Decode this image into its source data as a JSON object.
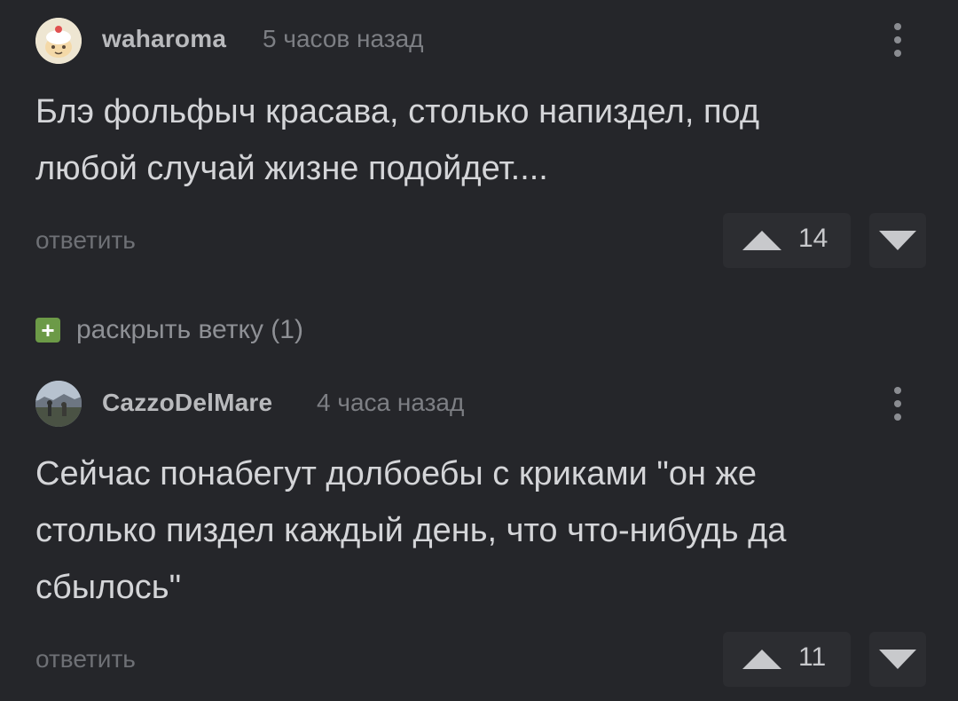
{
  "comments": [
    {
      "username": "waharoma",
      "time": "5 часов назад",
      "text": "Блэ фольфыч красава, столько напиздел, под любой случай жизне подойдет....",
      "reply_label": "ответить",
      "rating": "14",
      "avatar_icon": "cake-character-avatar-icon"
    },
    {
      "username": "CazzoDelMare",
      "time": "4 часа назад",
      "text": "Сейчас понабегут долбоебы с криками \"он же столько пиздел каждый день, что что-нибудь да сбылось\"",
      "reply_label": "ответить",
      "rating": "11",
      "avatar_icon": "landscape-photo-avatar-icon"
    }
  ],
  "expand_branch": {
    "icon": "plus-icon",
    "label": "раскрыть ветку (1)"
  },
  "colors": {
    "background": "#25262a",
    "expand_icon": "#6c9a47"
  }
}
